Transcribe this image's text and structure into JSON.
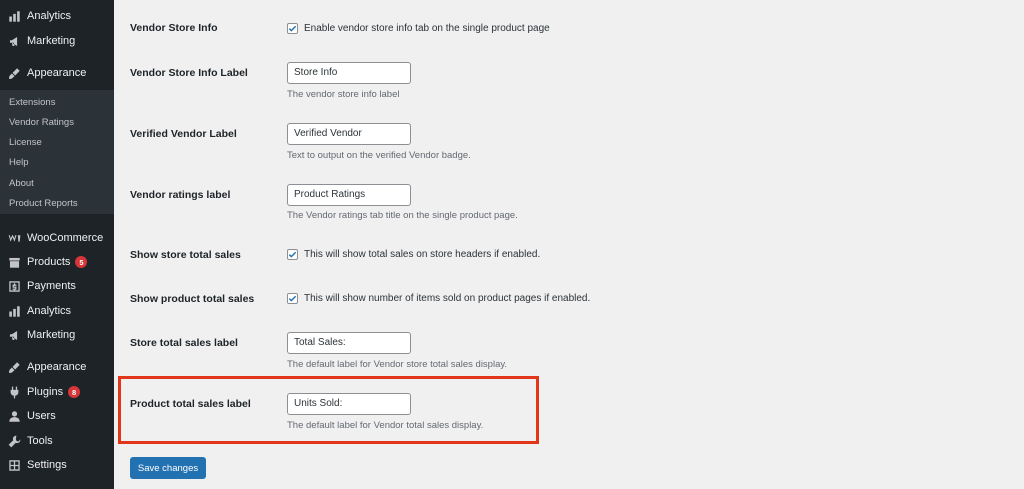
{
  "sidebar": {
    "items_top": [
      {
        "label": "Analytics",
        "icon": "analytics-icon"
      },
      {
        "label": "Marketing",
        "icon": "megaphone-icon"
      },
      {
        "label": "Appearance",
        "icon": "brush-icon"
      }
    ],
    "submenu": [
      "Extensions",
      "Vendor Ratings",
      "License",
      "Help",
      "About",
      "Product Reports"
    ],
    "items_bottom": [
      {
        "label": "WooCommerce",
        "icon": "woocommerce-icon"
      },
      {
        "label": "Products",
        "icon": "archive-icon",
        "badge": "5"
      },
      {
        "label": "Payments",
        "icon": "payments-icon"
      },
      {
        "label": "Analytics",
        "icon": "analytics-icon"
      },
      {
        "label": "Marketing",
        "icon": "megaphone-icon"
      },
      {
        "label": "Appearance",
        "icon": "brush-icon"
      },
      {
        "label": "Plugins",
        "icon": "plugin-icon",
        "badge": "8"
      },
      {
        "label": "Users",
        "icon": "users-icon"
      },
      {
        "label": "Tools",
        "icon": "tools-icon"
      },
      {
        "label": "Settings",
        "icon": "settings-icon"
      }
    ]
  },
  "settings": {
    "vendor_store_info": {
      "label": "Vendor Store Info",
      "checked": true,
      "text": "Enable vendor store info tab on the single product page"
    },
    "vendor_store_info_label": {
      "label": "Vendor Store Info Label",
      "value": "Store Info",
      "description": "The vendor store info label"
    },
    "verified_vendor_label": {
      "label": "Verified Vendor Label",
      "value": "Verified Vendor",
      "description": "Text to output on the verified Vendor badge."
    },
    "vendor_ratings_label": {
      "label": "Vendor ratings label",
      "value": "Product Ratings",
      "description": "The Vendor ratings tab title on the single product page."
    },
    "show_store_total_sales": {
      "label": "Show store total sales",
      "checked": true,
      "text": "This will show total sales on store headers if enabled."
    },
    "show_product_total_sales": {
      "label": "Show product total sales",
      "checked": true,
      "text": "This will show number of items sold on product pages if enabled."
    },
    "store_total_sales_label": {
      "label": "Store total sales label",
      "value": "Total Sales:",
      "description": "The default label for Vendor store total sales display."
    },
    "product_total_sales_label": {
      "label": "Product total sales label",
      "value": "Units Sold:",
      "description": "The default label for Vendor total sales display."
    }
  },
  "save_button": "Save changes",
  "colors": {
    "sidebar_bg": "#1d2327",
    "submenu_bg": "#2c3338",
    "primary_button": "#2271b1",
    "highlight_border": "#e2361b",
    "checkbox_check": "#2271b1",
    "badge": "#d63638"
  }
}
